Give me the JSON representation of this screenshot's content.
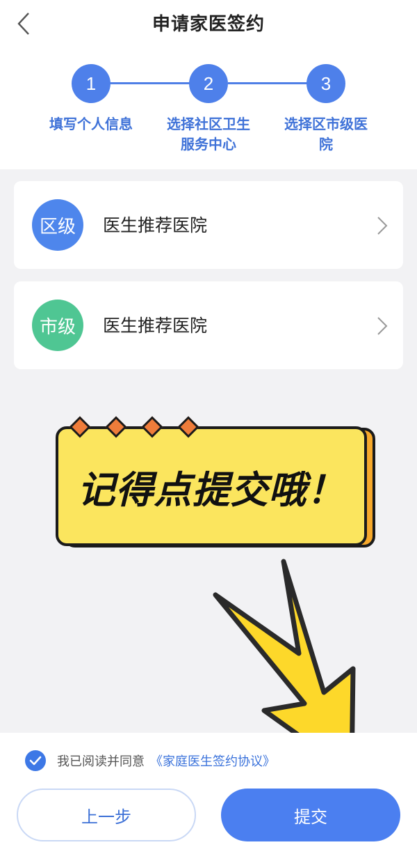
{
  "header": {
    "title": "申请家医签约",
    "back_icon": "chevron-left-icon"
  },
  "steps": [
    {
      "number": "1",
      "label": "填写个人信息"
    },
    {
      "number": "2",
      "label": "选择社区卫生服务中心"
    },
    {
      "number": "3",
      "label": "选择区市级医院"
    }
  ],
  "cards": [
    {
      "badge": "区级",
      "text": "医生推荐医院",
      "badge_color": "#4e86ec",
      "chevron_icon": "chevron-right-icon"
    },
    {
      "badge": "市级",
      "text": "医生推荐医院",
      "badge_color": "#4fc693",
      "chevron_icon": "chevron-right-icon"
    }
  ],
  "banner": {
    "text": "记得点提交哦！",
    "color": "#fbe55e"
  },
  "footer": {
    "agree_text": "我已阅读并同意",
    "agree_link": "《家庭医生签约协议》",
    "agree_checked": true,
    "prev_label": "上一步",
    "submit_label": "提交"
  },
  "colors": {
    "accent": "#4b7ff0",
    "step_blue": "#4e80ea",
    "arrow_yellow": "#fdd82a"
  }
}
